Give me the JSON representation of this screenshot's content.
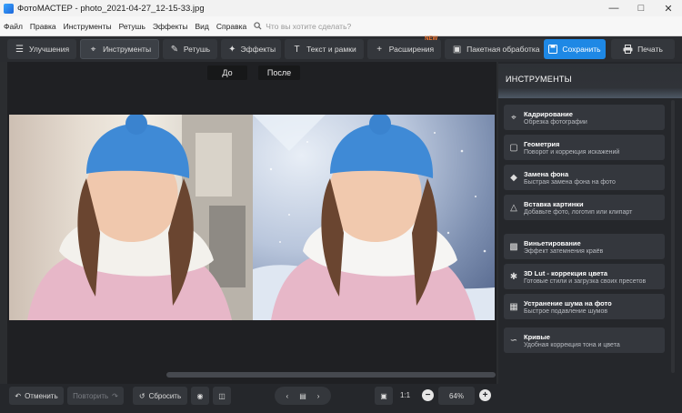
{
  "window": {
    "title": "ФотоМАСТЕР - photo_2021-04-27_12-15-33.jpg"
  },
  "menu": {
    "items": [
      "Файл",
      "Правка",
      "Инструменты",
      "Ретушь",
      "Эффекты",
      "Вид",
      "Справка"
    ],
    "search_placeholder": "Что вы хотите сделать?"
  },
  "toolbar": {
    "tabs": [
      "Улучшения",
      "Инструменты",
      "Ретушь",
      "Эффекты",
      "Текст и рамки",
      "Расширения",
      "Пакетная обработка"
    ],
    "new_badge": "NEW",
    "save": "Сохранить",
    "print": "Печать"
  },
  "compare": {
    "before": "До",
    "after": "После"
  },
  "panel": {
    "title": "ИНСТРУМЕНТЫ",
    "tools": [
      {
        "name": "Кадрирование",
        "desc": "Обрезка фотографии",
        "icon": "crop-icon"
      },
      {
        "name": "Геометрия",
        "desc": "Поворот и коррекция искажений",
        "icon": "geometry-icon"
      },
      {
        "name": "Замена фона",
        "desc": "Быстрая замена фона на фото",
        "icon": "background-icon"
      },
      {
        "name": "Вставка картинки",
        "desc": "Добавьте фото, логотип или клипарт",
        "icon": "insert-image-icon"
      },
      {
        "name": "Виньетирование",
        "desc": "Эффект затемнения краёв",
        "icon": "vignette-icon"
      },
      {
        "name": "3D Lut - коррекция цвета",
        "desc": "Готовые стили и загрузка своих пресетов",
        "icon": "lut-icon"
      },
      {
        "name": "Устранение шума на фото",
        "desc": "Быстрое подавление шумов",
        "icon": "denoise-icon"
      },
      {
        "name": "Кривые",
        "desc": "Удобная коррекция тона и цвета",
        "icon": "curves-icon"
      }
    ]
  },
  "bottom": {
    "undo": "Отменить",
    "redo": "Повторить",
    "reset": "Сбросить",
    "ratio": "1:1",
    "zoom": "64%"
  },
  "colors": {
    "accent": "#1e88e5",
    "new_badge": "#ff7a2f",
    "background": "#2b2d30"
  }
}
